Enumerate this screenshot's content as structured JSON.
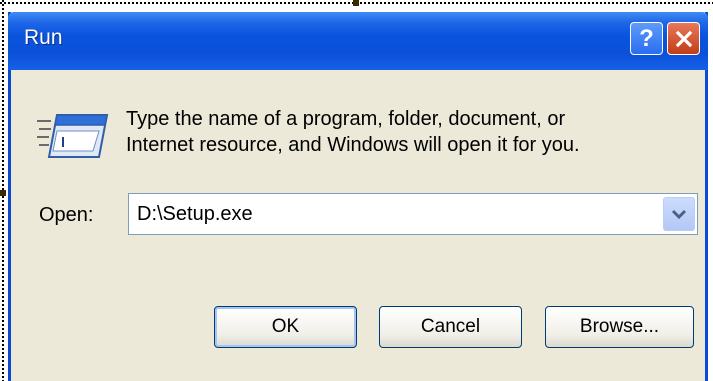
{
  "window": {
    "title": "Run"
  },
  "titlebar": {
    "help_label": "?",
    "help_icon": "question-mark-icon",
    "close_icon": "close-x-icon"
  },
  "dialog": {
    "icon": "run-program-icon",
    "message_line1": "Type the name of a program, folder, document, or",
    "message_line2": "Internet resource, and Windows will open it for you.",
    "open_label": "Open:",
    "open_value": "D:\\Setup.exe",
    "dropdown_icon": "chevron-down-icon"
  },
  "buttons": {
    "ok": "OK",
    "cancel": "Cancel",
    "browse": "Browse..."
  },
  "colors": {
    "titlebar_blue": "#0a55de",
    "close_red": "#c13d17",
    "dialog_bg": "#ece9d8"
  }
}
